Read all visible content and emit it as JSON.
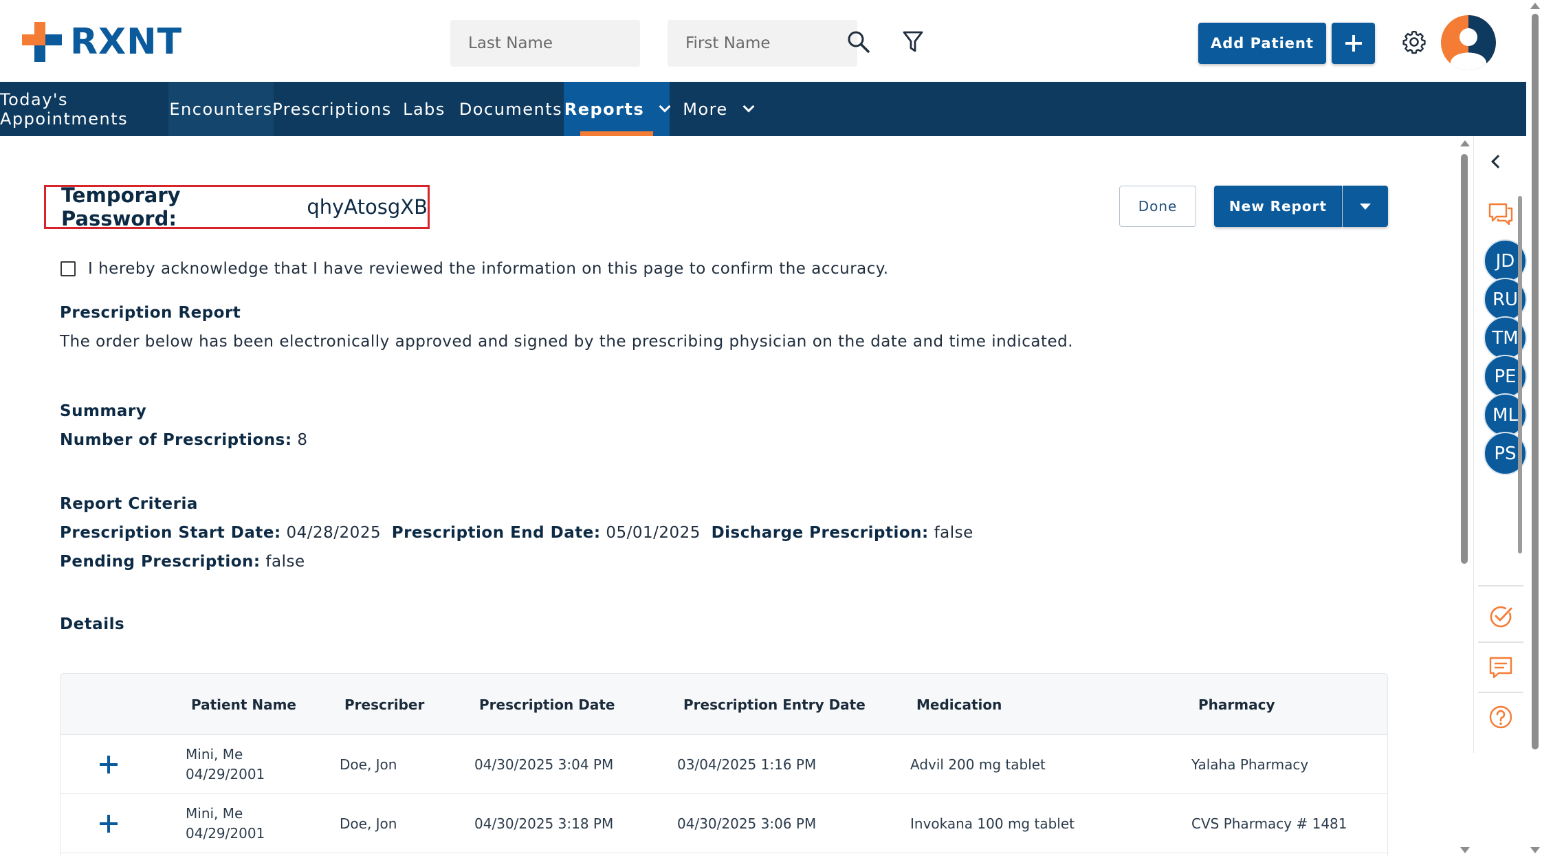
{
  "header": {
    "logo_text": "RXNT",
    "last_name_placeholder": "Last Name",
    "first_name_placeholder": "First Name",
    "add_patient_label": "Add Patient"
  },
  "nav": {
    "items": [
      {
        "label": "Today's Appointments"
      },
      {
        "label": "Encounters"
      },
      {
        "label": "Prescriptions"
      },
      {
        "label": "Labs"
      },
      {
        "label": "Documents"
      },
      {
        "label": "Reports"
      },
      {
        "label": "More"
      }
    ],
    "active": "Reports"
  },
  "page": {
    "temp_password_label": "Temporary Password:",
    "temp_password_value": "qhyAtosgXB",
    "done_label": "Done",
    "new_report_label": "New Report",
    "acknowledge_text": "I hereby acknowledge that I have reviewed the information on this page to confirm the accuracy.",
    "report_title": "Prescription Report",
    "report_desc": "The order below has been electronically approved and signed by the prescribing physician on the date and time indicated.",
    "summary_title": "Summary",
    "num_prescriptions_label": "Number of Prescriptions:",
    "num_prescriptions_value": "8",
    "criteria_title": "Report Criteria",
    "start_date_label": "Prescription Start Date:",
    "start_date_value": "04/28/2025",
    "end_date_label": "Prescription End Date:",
    "end_date_value": "05/01/2025",
    "discharge_label": "Discharge Prescription:",
    "discharge_value": "false",
    "pending_label": "Pending Prescription:",
    "pending_value": "false",
    "details_title": "Details"
  },
  "table": {
    "columns": [
      "Patient Name",
      "Prescriber",
      "Prescription Date",
      "Prescription Entry Date",
      "Medication",
      "Pharmacy"
    ],
    "rows": [
      {
        "patient_name": "Mini, Me",
        "patient_dob": "04/29/2001",
        "prescriber": "Doe, Jon",
        "rx_date": "04/30/2025 3:04 PM",
        "entry_date": "03/04/2025 1:16 PM",
        "medication": "Advil 200 mg tablet",
        "pharmacy": "Yalaha Pharmacy"
      },
      {
        "patient_name": "Mini, Me",
        "patient_dob": "04/29/2001",
        "prescriber": "Doe, Jon",
        "rx_date": "04/30/2025 3:18 PM",
        "entry_date": "04/30/2025 3:06 PM",
        "medication": "Invokana 100 mg tablet",
        "pharmacy": "CVS Pharmacy # 1481"
      }
    ]
  },
  "right_panel": {
    "users": [
      "JD",
      "RU",
      "TM",
      "PE",
      "ML",
      "PS"
    ]
  },
  "colors": {
    "brand_blue": "#0a5a9c",
    "nav_bg": "#0d3a5e",
    "accent_orange": "#f47c34",
    "highlight_red": "#d8232a"
  }
}
